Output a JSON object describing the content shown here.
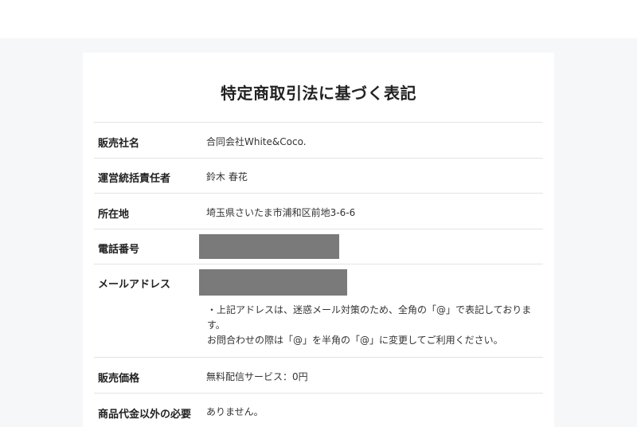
{
  "page": {
    "title": "特定商取引法に基づく表記"
  },
  "rows": [
    {
      "label": "販売社名",
      "value": "合同会社White&Coco."
    },
    {
      "label": "運営統括責任者",
      "value": "鈴木 春花"
    },
    {
      "label": "所在地",
      "value": "埼玉県さいたま市浦和区前地3-6-6"
    },
    {
      "label": "電話番号",
      "value": ""
    },
    {
      "label": "メールアドレス",
      "value": ""
    },
    {
      "label": "販売価格",
      "value": "無料配信サービス：0円"
    },
    {
      "label": "商品代金以外の必要",
      "value": "ありません。"
    }
  ],
  "email_note": {
    "line1": "・上記アドレスは、迷惑メール対策のため、全角の「@」で表記しておりま",
    "line2": "す。",
    "line3": "お問合わせの際は「@」を半角の「@」に変更してご利用ください。"
  },
  "colors": {
    "background": "#f6f7f9",
    "card": "#ffffff",
    "divider": "#e4e4e4",
    "redaction": "#7a7a7a"
  }
}
